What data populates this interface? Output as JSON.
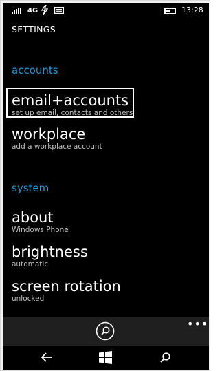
{
  "status_bar": {
    "network": "4G",
    "time": "13:28",
    "icons": [
      "signal-icon",
      "data-sync-icon",
      "message-icon",
      "battery-icon"
    ]
  },
  "header": {
    "title": "SETTINGS"
  },
  "sections": [
    {
      "header": "accounts",
      "items": [
        {
          "title": "email+accounts",
          "subtitle": "set up email, contacts and others",
          "focused": true
        },
        {
          "title": "workplace",
          "subtitle": "add a workplace account"
        }
      ]
    },
    {
      "header": "system",
      "items": [
        {
          "title": "about",
          "subtitle": "Windows Phone"
        },
        {
          "title": "brightness",
          "subtitle": "automatic"
        },
        {
          "title": "screen rotation",
          "subtitle": "unlocked"
        }
      ]
    }
  ],
  "app_bar": {
    "primary_icon": "search-icon",
    "more_label": "•••"
  },
  "nav_bar": {
    "icons": [
      "back-icon",
      "windows-start-icon",
      "search-icon"
    ]
  },
  "colors": {
    "background": "#000000",
    "accent": "#1a9ad9",
    "text": "#ffffff",
    "subtext": "#bdbdbd",
    "app_bar": "#1f1f1f"
  }
}
